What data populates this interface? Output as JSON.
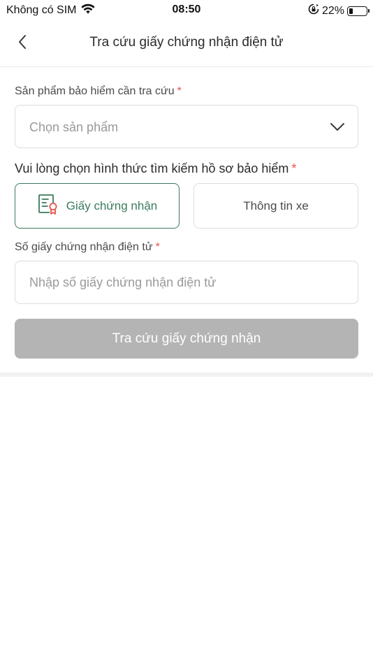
{
  "status_bar": {
    "carrier": "Không có SIM",
    "time": "08:50",
    "battery_percent": "22%",
    "battery_level": 0.22,
    "icons": [
      "wifi-icon",
      "orientation-lock-icon",
      "battery-icon"
    ]
  },
  "nav": {
    "title": "Tra cứu giấy chứng nhận điện tử",
    "back_icon": "chevron-left-icon"
  },
  "product_field": {
    "label": "Sản phẩm bảo hiểm cần tra cứu",
    "required_mark": "*",
    "placeholder": "Chọn sản phẩm",
    "icon": "chevron-down-icon"
  },
  "search_method": {
    "title": "Vui lòng chọn hình thức tìm kiếm hồ sơ bảo hiểm",
    "required_mark": "*",
    "options": [
      {
        "label": "Giấy chứng nhận",
        "icon": "certificate-icon",
        "selected": true
      },
      {
        "label": "Thông tin xe",
        "selected": false
      }
    ]
  },
  "certificate_field": {
    "label": "Số giấy chứng nhận điện tử",
    "required_mark": "*",
    "placeholder": "Nhập số giấy chứng nhận điện tử"
  },
  "submit": {
    "label": "Tra cứu giấy chứng nhận",
    "enabled": false
  },
  "colors": {
    "accent": "#3b7b5c",
    "required": "#e5534b",
    "disabled_button": "#b4b4b4",
    "border": "#dcdcdc"
  }
}
